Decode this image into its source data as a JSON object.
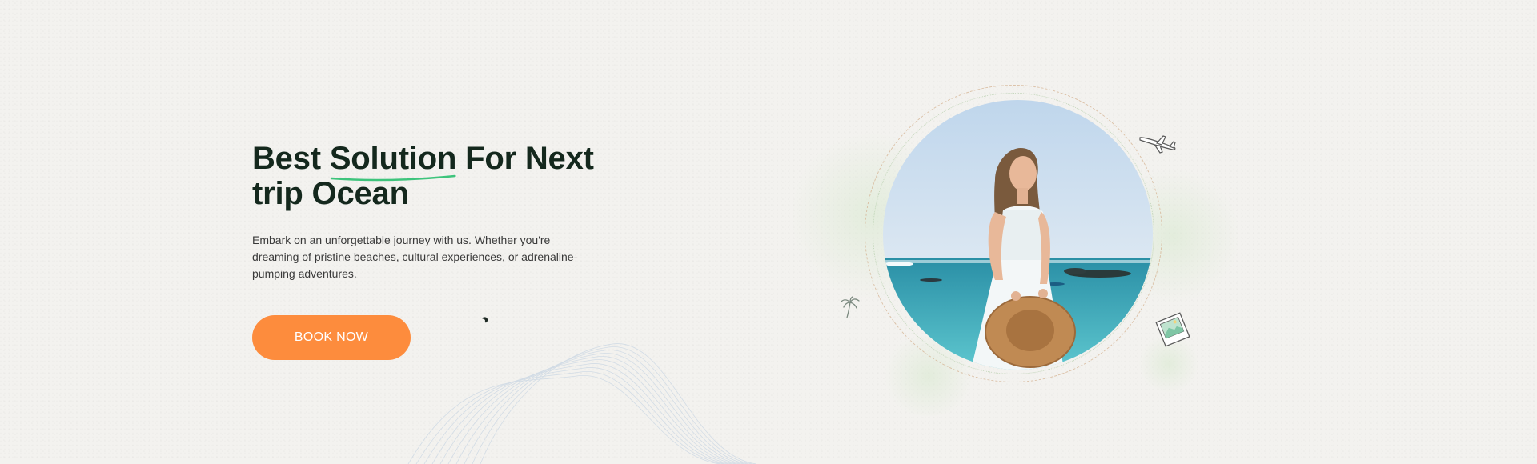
{
  "hero": {
    "title_before": "Best ",
    "title_highlight": "Solution",
    "title_after": " For Next trip Ocean",
    "description": "Embark on an unforgettable journey with us. Whether you're dreaming of pristine beaches, cultural experiences, or adrenaline-pumping adventures.",
    "cta_label": "BOOK NOW"
  },
  "colors": {
    "background": "#f3f2ef",
    "title": "#14281d",
    "accent": "#fd8c3d",
    "underline": "#3ec47c"
  },
  "icons": {
    "plane": "airplane-icon",
    "palm": "palm-tree-icon",
    "photo": "photo-frame-icon"
  }
}
